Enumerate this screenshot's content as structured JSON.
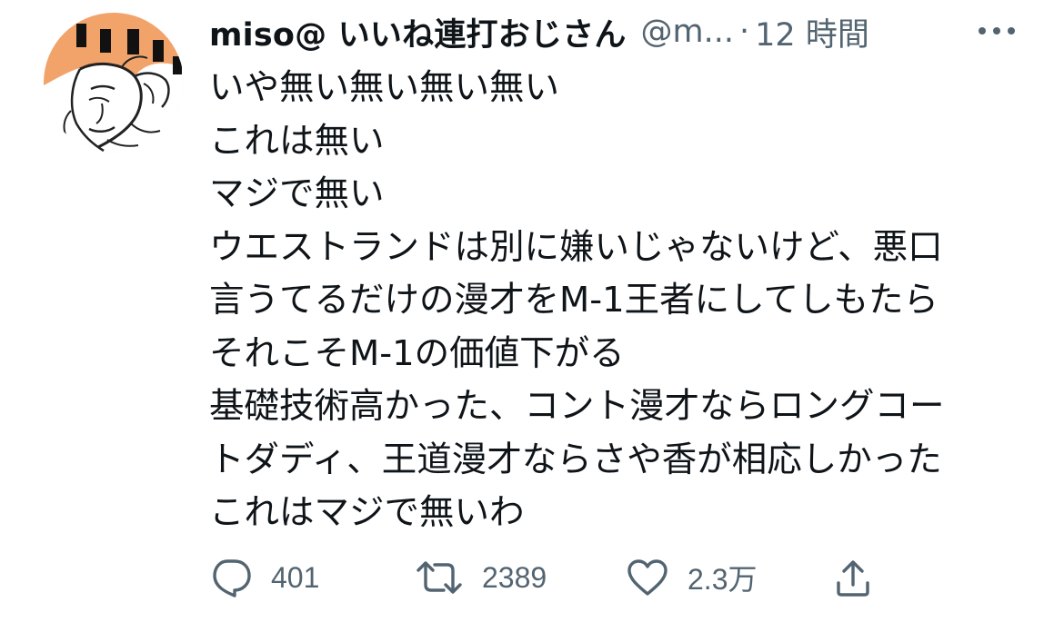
{
  "tweet": {
    "display_name": "miso@ いいね連打おじさん",
    "handle": "@m...",
    "separator": "·",
    "time": "12 時間",
    "more_icon": "more-horizontal-icon",
    "avatar_icon": "avatar-manga-portrait",
    "lines": [
      "いや無い無い無い無い",
      "これは無い",
      "マジで無い",
      "ウエストランドは別に嫌いじゃないけど、悪口",
      "言うてるだけの漫才をM-1王者にしてしもたら",
      "それこそM-1の価値下がる",
      "基礎技術高かった、コント漫才ならロングコー",
      "トダディ、王道漫才ならさや香が相応しかった",
      "これはマジで無いわ"
    ]
  },
  "actions": {
    "reply": {
      "icon": "reply-bubble-icon",
      "count": "401"
    },
    "retweet": {
      "icon": "retweet-icon",
      "count": "2389"
    },
    "like": {
      "icon": "heart-icon",
      "count": "2.3万"
    },
    "share": {
      "icon": "share-upload-icon"
    }
  },
  "colors": {
    "text": "#0f1419",
    "secondary": "#536471",
    "background": "#ffffff"
  }
}
